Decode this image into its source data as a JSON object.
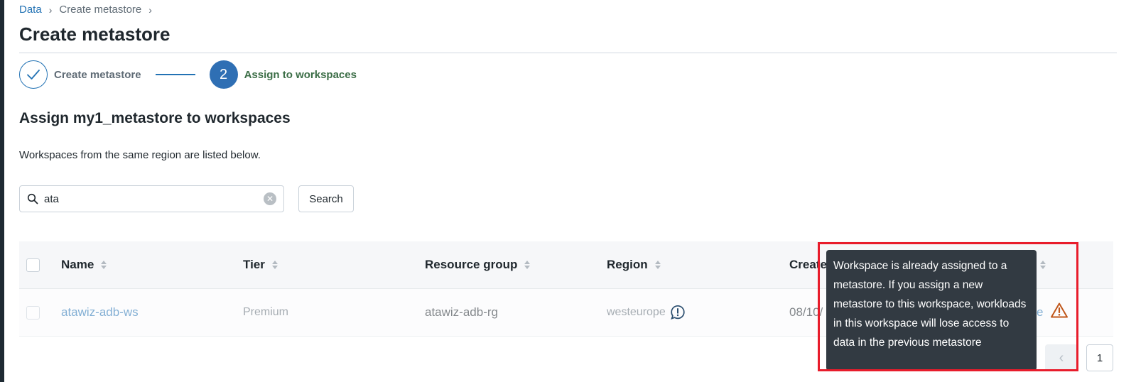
{
  "breadcrumb": {
    "items": [
      "Data",
      "Create metastore"
    ],
    "separator": "›"
  },
  "page": {
    "title": "Create metastore"
  },
  "steps": [
    {
      "label": "Create metastore",
      "status": "done",
      "icon": "check-icon"
    },
    {
      "number": "2",
      "label": "Assign to workspaces",
      "status": "active"
    }
  ],
  "section": {
    "title": "Assign my1_metastore to workspaces",
    "description": "Workspaces from the same region are listed below."
  },
  "search": {
    "value": "ata",
    "button_label": "Search"
  },
  "table": {
    "columns": [
      "Name",
      "Tier",
      "Resource group",
      "Region",
      "Create"
    ],
    "rows": [
      {
        "name": "atawiz-adb-ws",
        "tier": "Premium",
        "resource_group": "atawiz-adb-rg",
        "region": "westeurope",
        "created": "08/10/",
        "tail": "e"
      }
    ]
  },
  "tooltip": {
    "text": "Workspace is already assigned to a metastore. If you assign a new metastore to this workspace, workloads in this workspace will lose access to data in the previous metastore"
  },
  "pagination": {
    "current_page": "1",
    "prev_icon": "chevron-left-icon"
  },
  "colors": {
    "accent": "#2272b4",
    "step_active_bg": "#2f6fb4",
    "step_active_text": "#3c6e47",
    "warning": "#c0561a",
    "tooltip_bg": "#323a42",
    "highlight": "#e81c2b"
  }
}
